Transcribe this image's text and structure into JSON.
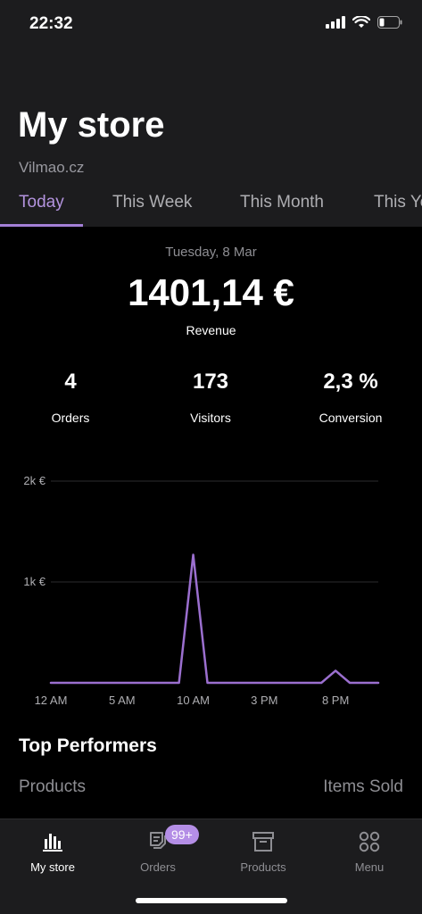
{
  "status_bar": {
    "time": "22:32"
  },
  "header": {
    "title": "My store",
    "subtitle": "Vilmao.cz",
    "tabs": [
      {
        "label": "Today",
        "active": true
      },
      {
        "label": "This Week",
        "active": false
      },
      {
        "label": "This Month",
        "active": false
      },
      {
        "label": "This Year",
        "active": false
      }
    ]
  },
  "summary": {
    "date": "Tuesday, 8 Mar",
    "revenue_value": "1401,14 €",
    "revenue_label": "Revenue",
    "stats": [
      {
        "value": "4",
        "label": "Orders"
      },
      {
        "value": "173",
        "label": "Visitors"
      },
      {
        "value": "2,3 %",
        "label": "Conversion"
      }
    ]
  },
  "chart_data": {
    "type": "line",
    "title": "",
    "xlabel": "",
    "ylabel": "",
    "x_ticks": [
      "12 AM",
      "5 AM",
      "10 AM",
      "3 PM",
      "8 PM"
    ],
    "y_ticks": [
      "1k €",
      "2k €"
    ],
    "ylim": [
      0,
      2000
    ],
    "xlim": [
      0,
      23
    ],
    "grid": true,
    "accent_color": "#9b6fcf",
    "series": [
      {
        "x": [
          0,
          1,
          2,
          3,
          4,
          5,
          6,
          7,
          8,
          9,
          10,
          11,
          12,
          13,
          14,
          15,
          16,
          17,
          18,
          19,
          20,
          21,
          22,
          23
        ],
        "values": [
          0,
          0,
          0,
          0,
          0,
          0,
          0,
          0,
          0,
          0,
          1270,
          0,
          0,
          0,
          0,
          0,
          0,
          0,
          0,
          0,
          120,
          0,
          0,
          0
        ]
      }
    ]
  },
  "top_performers": {
    "title": "Top Performers",
    "col_products": "Products",
    "col_items_sold": "Items Sold"
  },
  "tab_bar": {
    "items": [
      {
        "label": "My store",
        "icon": "bar-chart-icon",
        "active": true
      },
      {
        "label": "Orders",
        "icon": "orders-icon",
        "active": false,
        "badge": "99+"
      },
      {
        "label": "Products",
        "icon": "archive-box-icon",
        "active": false
      },
      {
        "label": "Menu",
        "icon": "grid-circles-icon",
        "active": false
      }
    ]
  }
}
